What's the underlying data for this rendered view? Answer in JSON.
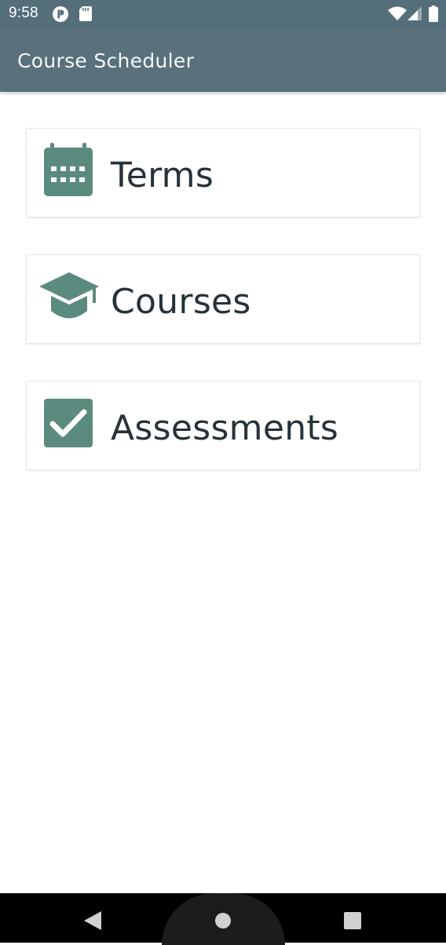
{
  "status_bar": {
    "time": "9:58",
    "icons_left": [
      "p-circle-icon",
      "sd-card-icon"
    ],
    "icons_right": [
      "wifi-icon",
      "cell-signal-icon",
      "battery-icon"
    ]
  },
  "app_bar": {
    "title": "Course Scheduler"
  },
  "menu": {
    "items": [
      {
        "label": "Terms",
        "icon": "calendar-icon"
      },
      {
        "label": "Courses",
        "icon": "graduation-cap-icon"
      },
      {
        "label": "Assessments",
        "icon": "checkbox-icon"
      }
    ]
  },
  "nav_bar": {
    "buttons": [
      "back-icon",
      "home-icon",
      "recents-icon"
    ]
  },
  "colors": {
    "status_bar": "#546e7a",
    "app_bar": "#58717c",
    "icon_accent": "#5b8b7f",
    "label_text": "#263238",
    "nav_bar": "#000000"
  }
}
